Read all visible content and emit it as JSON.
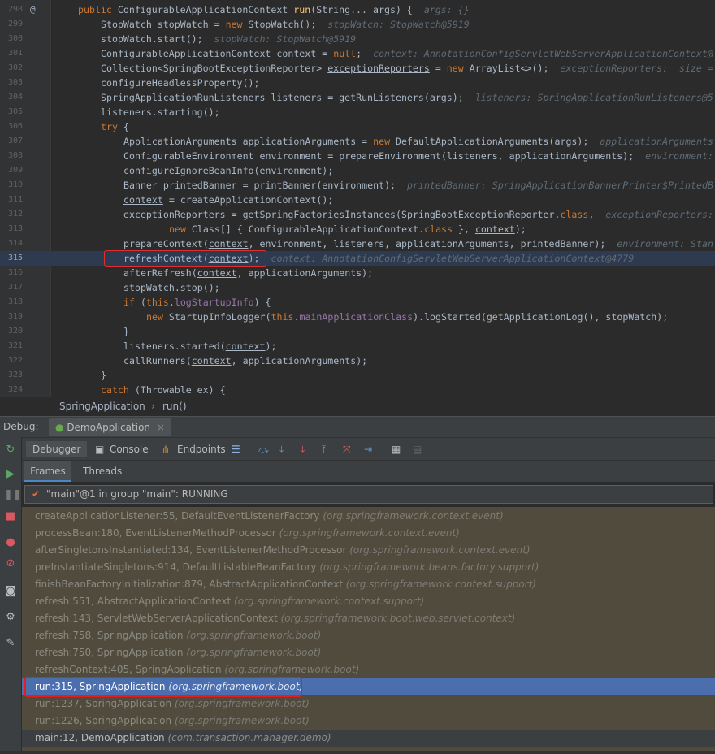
{
  "editor": {
    "lines": [
      {
        "num": "298",
        "mark": "@",
        "indent": 4,
        "parts": [
          [
            "kw",
            "public "
          ],
          [
            "pl",
            "ConfigurableApplicationContext "
          ],
          [
            "fn",
            "run"
          ],
          [
            "pl",
            "(String... args) {  "
          ],
          [
            "hint",
            "args: {}"
          ]
        ]
      },
      {
        "num": "299",
        "indent": 8,
        "parts": [
          [
            "pl",
            "StopWatch stopWatch = "
          ],
          [
            "kw",
            "new "
          ],
          [
            "pl",
            "StopWatch();  "
          ],
          [
            "hint",
            "stopWatch: StopWatch@5919"
          ]
        ]
      },
      {
        "num": "300",
        "indent": 8,
        "parts": [
          [
            "pl",
            "stopWatch.start();  "
          ],
          [
            "hint",
            "stopWatch: StopWatch@5919"
          ]
        ]
      },
      {
        "num": "301",
        "indent": 8,
        "parts": [
          [
            "pl",
            "ConfigurableApplicationContext "
          ],
          [
            "ul",
            "context"
          ],
          [
            "pl",
            " = "
          ],
          [
            "kw",
            "null"
          ],
          [
            "pl",
            ";  "
          ],
          [
            "hint",
            "context: AnnotationConfigServletWebServerApplicationContext@"
          ]
        ]
      },
      {
        "num": "302",
        "indent": 8,
        "parts": [
          [
            "pl",
            "Collection<SpringBootExceptionReporter> "
          ],
          [
            "ul",
            "exceptionReporters"
          ],
          [
            "pl",
            " = "
          ],
          [
            "kw",
            "new "
          ],
          [
            "pl",
            "ArrayList<>();  "
          ],
          [
            "hint",
            "exceptionReporters:  size ="
          ]
        ]
      },
      {
        "num": "303",
        "indent": 8,
        "parts": [
          [
            "pl",
            "configureHeadlessProperty();"
          ]
        ]
      },
      {
        "num": "304",
        "indent": 8,
        "parts": [
          [
            "pl",
            "SpringApplicationRunListeners listeners = getRunListeners(args);  "
          ],
          [
            "hint",
            "listeners: SpringApplicationRunListeners@5"
          ]
        ]
      },
      {
        "num": "305",
        "indent": 8,
        "parts": [
          [
            "pl",
            "listeners.starting();"
          ]
        ]
      },
      {
        "num": "306",
        "indent": 8,
        "parts": [
          [
            "kw",
            "try "
          ],
          [
            "pl",
            "{"
          ]
        ]
      },
      {
        "num": "307",
        "indent": 12,
        "parts": [
          [
            "pl",
            "ApplicationArguments applicationArguments = "
          ],
          [
            "kw",
            "new "
          ],
          [
            "pl",
            "DefaultApplicationArguments(args);  "
          ],
          [
            "hint",
            "applicationArguments"
          ]
        ]
      },
      {
        "num": "308",
        "indent": 12,
        "parts": [
          [
            "pl",
            "ConfigurableEnvironment environment = prepareEnvironment(listeners, applicationArguments);  "
          ],
          [
            "hint",
            "environment:"
          ]
        ]
      },
      {
        "num": "309",
        "indent": 12,
        "parts": [
          [
            "pl",
            "configureIgnoreBeanInfo(environment);"
          ]
        ]
      },
      {
        "num": "310",
        "indent": 12,
        "parts": [
          [
            "pl",
            "Banner printedBanner = printBanner(environment);  "
          ],
          [
            "hint",
            "printedBanner: SpringApplicationBannerPrinter$PrintedB"
          ]
        ]
      },
      {
        "num": "311",
        "indent": 12,
        "parts": [
          [
            "ul",
            "context"
          ],
          [
            "pl",
            " = createApplicationContext();"
          ]
        ]
      },
      {
        "num": "312",
        "indent": 12,
        "parts": [
          [
            "ul",
            "exceptionReporters"
          ],
          [
            "pl",
            " = getSpringFactoriesInstances(SpringBootExceptionReporter."
          ],
          [
            "kw",
            "class"
          ],
          [
            "pl",
            ",  "
          ],
          [
            "hint",
            "exceptionReporters:"
          ]
        ]
      },
      {
        "num": "313",
        "indent": 20,
        "parts": [
          [
            "kw",
            "new "
          ],
          [
            "pl",
            "Class[] { ConfigurableApplicationContext."
          ],
          [
            "kw",
            "class "
          ],
          [
            "pl",
            "}, "
          ],
          [
            "ul",
            "context"
          ],
          [
            "pl",
            ");"
          ]
        ]
      },
      {
        "num": "314",
        "indent": 12,
        "parts": [
          [
            "pl",
            "prepareContext("
          ],
          [
            "ul",
            "context"
          ],
          [
            "pl",
            ", environment, listeners, applicationArguments, printedBanner);  "
          ],
          [
            "hint",
            "environment: Stan"
          ]
        ]
      },
      {
        "num": "315",
        "indent": 12,
        "current": true,
        "parts": [
          [
            "pl",
            "refreshContext("
          ],
          [
            "ul",
            "context"
          ],
          [
            "pl",
            ");  "
          ],
          [
            "hint",
            "context: AnnotationConfigServletWebServerApplicationContext@4779"
          ]
        ]
      },
      {
        "num": "316",
        "indent": 12,
        "parts": [
          [
            "pl",
            "afterRefresh("
          ],
          [
            "ul",
            "context"
          ],
          [
            "pl",
            ", applicationArguments);"
          ]
        ]
      },
      {
        "num": "317",
        "indent": 12,
        "parts": [
          [
            "pl",
            "stopWatch.stop();"
          ]
        ]
      },
      {
        "num": "318",
        "indent": 12,
        "parts": [
          [
            "kw",
            "if "
          ],
          [
            "pl",
            "("
          ],
          [
            "kw",
            "this"
          ],
          [
            "pl",
            "."
          ],
          [
            "fd",
            "logStartupInfo"
          ],
          [
            "pl",
            ") {"
          ]
        ]
      },
      {
        "num": "319",
        "indent": 16,
        "parts": [
          [
            "kw",
            "new "
          ],
          [
            "pl",
            "StartupInfoLogger("
          ],
          [
            "kw",
            "this"
          ],
          [
            "pl",
            "."
          ],
          [
            "fd",
            "mainApplicationClass"
          ],
          [
            "pl",
            ").logStarted(getApplicationLog(), stopWatch);"
          ]
        ]
      },
      {
        "num": "320",
        "indent": 12,
        "parts": [
          [
            "pl",
            "}"
          ]
        ]
      },
      {
        "num": "321",
        "indent": 12,
        "parts": [
          [
            "pl",
            "listeners.started("
          ],
          [
            "ul",
            "context"
          ],
          [
            "pl",
            ");"
          ]
        ]
      },
      {
        "num": "322",
        "indent": 12,
        "parts": [
          [
            "pl",
            "callRunners("
          ],
          [
            "ul",
            "context"
          ],
          [
            "pl",
            ", applicationArguments);"
          ]
        ]
      },
      {
        "num": "323",
        "indent": 8,
        "parts": [
          [
            "pl",
            "}"
          ]
        ]
      },
      {
        "num": "324",
        "indent": 8,
        "parts": [
          [
            "kw",
            "catch "
          ],
          [
            "pl",
            "(Throwable ex) {"
          ]
        ]
      }
    ]
  },
  "breadcrumb": {
    "class_name": "SpringApplication",
    "separator": "›",
    "method": "run()"
  },
  "debug": {
    "label": "Debug:",
    "session": "DemoApplication",
    "session_close": "×",
    "tabs": {
      "debugger": "Debugger",
      "console": "Console",
      "endpoints": "Endpoints"
    },
    "subtabs": {
      "frames": "Frames",
      "threads": "Threads"
    },
    "thread": "\"main\"@1 in group \"main\": RUNNING"
  },
  "frames": [
    {
      "method": "createApplicationListener:55, DefaultEventListenerFactory",
      "pkg": "(org.springframework.context.event)"
    },
    {
      "method": "processBean:180, EventListenerMethodProcessor",
      "pkg": "(org.springframework.context.event)"
    },
    {
      "method": "afterSingletonsInstantiated:134, EventListenerMethodProcessor",
      "pkg": "(org.springframework.context.event)"
    },
    {
      "method": "preInstantiateSingletons:914, DefaultListableBeanFactory",
      "pkg": "(org.springframework.beans.factory.support)"
    },
    {
      "method": "finishBeanFactoryInitialization:879, AbstractApplicationContext",
      "pkg": "(org.springframework.context.support)"
    },
    {
      "method": "refresh:551, AbstractApplicationContext",
      "pkg": "(org.springframework.context.support)"
    },
    {
      "method": "refresh:143, ServletWebServerApplicationContext",
      "pkg": "(org.springframework.boot.web.servlet.context)"
    },
    {
      "method": "refresh:758, SpringApplication",
      "pkg": "(org.springframework.boot)"
    },
    {
      "method": "refresh:750, SpringApplication",
      "pkg": "(org.springframework.boot)"
    },
    {
      "method": "refreshContext:405, SpringApplication",
      "pkg": "(org.springframework.boot)"
    },
    {
      "method": "run:315, SpringApplication",
      "pkg": "(org.springframework.boot)",
      "selected": true
    },
    {
      "method": "run:1237, SpringApplication",
      "pkg": "(org.springframework.boot)"
    },
    {
      "method": "run:1226, SpringApplication",
      "pkg": "(org.springframework.boot)"
    },
    {
      "method": "main:12, DemoApplication",
      "pkg": "(com.transaction.manager.demo)",
      "plain": true
    }
  ],
  "colors": {
    "keyword": "#cc7832",
    "method": "#ffc66d",
    "field": "#9876aa",
    "selected": "#4b6eaf",
    "highlight": "#e81c1c"
  }
}
